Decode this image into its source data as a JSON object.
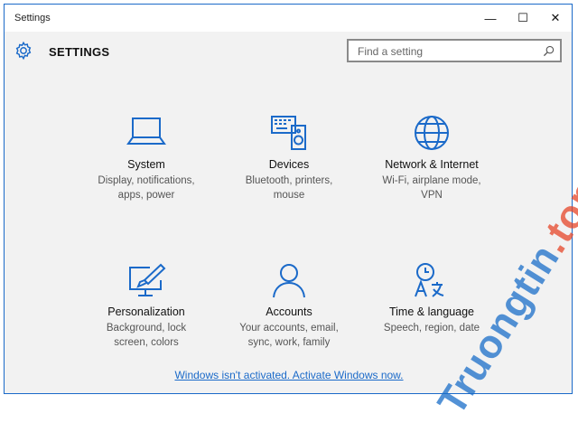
{
  "window": {
    "title": "Settings",
    "minimize_glyph": "—",
    "maximize_glyph": "☐",
    "close_glyph": "✕"
  },
  "header": {
    "title": "SETTINGS",
    "icon": "gear-icon",
    "search": {
      "placeholder": "Find a setting",
      "icon": "search-icon"
    }
  },
  "tiles": [
    {
      "title": "System",
      "desc_line1": "Display, notifications,",
      "desc_line2": "apps, power",
      "icon": "laptop-icon"
    },
    {
      "title": "Devices",
      "desc_line1": "Bluetooth, printers,",
      "desc_line2": "mouse",
      "icon": "keyboard-speaker-icon"
    },
    {
      "title": "Network & Internet",
      "desc_line1": "Wi-Fi, airplane mode,",
      "desc_line2": "VPN",
      "icon": "globe-icon"
    },
    {
      "title": "Personalization",
      "desc_line1": "Background, lock",
      "desc_line2": "screen, colors",
      "icon": "paint-monitor-icon"
    },
    {
      "title": "Accounts",
      "desc_line1": "Your accounts, email,",
      "desc_line2": "sync, work, family",
      "icon": "person-icon"
    },
    {
      "title": "Time & language",
      "desc_line1": "Speech, region, date",
      "desc_line2": "",
      "icon": "clock-language-icon"
    }
  ],
  "activation_link": "Windows isn't activated. Activate Windows now.",
  "watermark": {
    "part1": "Truongtin",
    "part2": ".top"
  },
  "colors": {
    "accent": "#1b6ac9",
    "background": "#f2f2f2"
  }
}
